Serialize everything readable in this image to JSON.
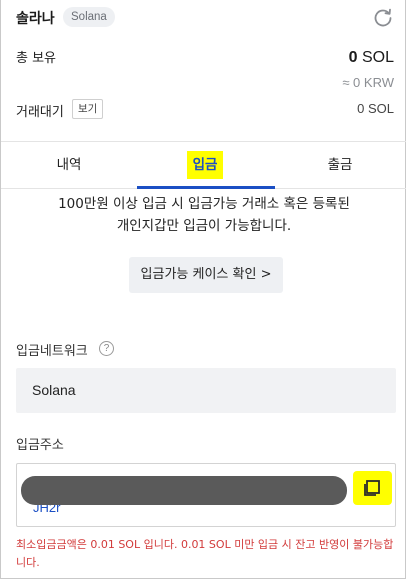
{
  "header": {
    "title": "솔라나",
    "code": "Solana",
    "refresh_icon": "refresh-icon"
  },
  "holdings": {
    "total_label": "총 보유",
    "total_amount": "0",
    "total_unit": "SOL",
    "krw_value": "≈ 0 KRW",
    "waiting_label": "거래대기",
    "view_label": "보기",
    "waiting_value": "0 SOL"
  },
  "tabs": [
    {
      "label": "내역"
    },
    {
      "label": "입금",
      "active": true
    },
    {
      "label": "출금"
    }
  ],
  "notice": {
    "line1": "100만원 이상 입금 시 입금가능 거래소 혹은 등록된",
    "line2": "개인지갑만 입금이 가능합니다.",
    "case_button": "입금가능 케이스 확인 >"
  },
  "network": {
    "label": "입금네트워크",
    "help_icon": "?",
    "value": "Solana"
  },
  "address": {
    "label": "입금주소",
    "value_visible": "JH2r",
    "copy_icon": "copy-icon"
  },
  "warning": "최소입금금액은 0.01 SOL 입니다. 0.01 SOL 미만 입금 시 잔고 반영이 불가능합니다.",
  "colors": {
    "accent": "#1b4fc4",
    "highlight": "#ffff00",
    "warning": "#d23a3a"
  }
}
